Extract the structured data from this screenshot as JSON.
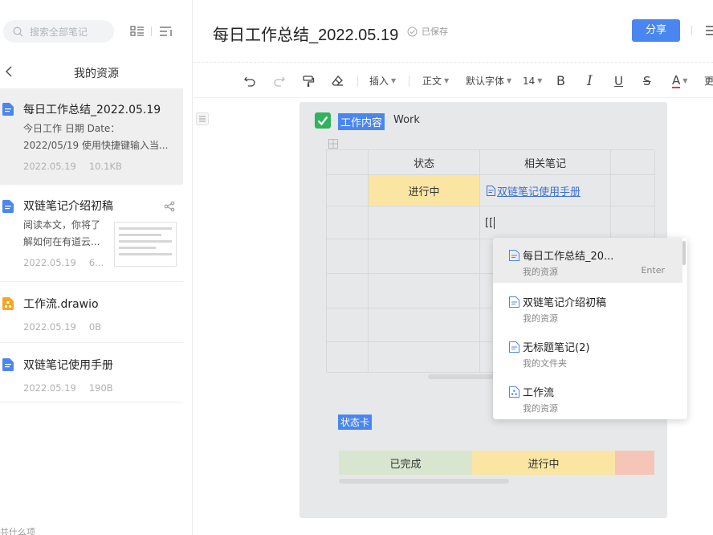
{
  "sidebar": {
    "search_placeholder": "搜索全部笔记",
    "folder_title": "我的资源",
    "files": [
      {
        "title": "每日工作总结_2022.05.19",
        "desc_line1": "今日工作 日期 Date：",
        "desc_line2": "2022/05/19 使用快捷键输入当...",
        "date": "2022.05.19",
        "size": "10.1KB"
      },
      {
        "title": "双链笔记介绍初稿",
        "desc_line1": "阅读本文，你将了",
        "desc_line2": "解如何在有道云...",
        "date": "2022.05.19",
        "size": "6..."
      },
      {
        "title": "工作流.drawio",
        "date": "2022.05.19",
        "size": "0B"
      },
      {
        "title": "双链笔记使用手册",
        "date": "2022.05.19",
        "size": "190B"
      }
    ],
    "footer": "共什么项"
  },
  "header": {
    "title": "每日工作总结_2022.05.19",
    "saved_status": "已保存",
    "share_label": "分享"
  },
  "toolbar": {
    "insert": "插入",
    "paragraph": "正文",
    "font": "默认字体",
    "size": "14",
    "bold": "B",
    "italic": "I",
    "underline": "U",
    "strike": "S",
    "color": "A",
    "more": "更"
  },
  "editor": {
    "heading_chip": "工作内容",
    "heading_text": "Work",
    "table": {
      "headers": [
        "状态",
        "相关笔记"
      ],
      "row1_status": "进行中",
      "row1_link": "双链笔记使用手册",
      "row2_typing": "[["
    },
    "status_chip": "状态卡",
    "status_bar": [
      "已完成",
      "进行中"
    ]
  },
  "link_popup": {
    "items": [
      {
        "title": "每日工作总结_20...",
        "location": "我的资源",
        "shortcut": "Enter"
      },
      {
        "title": "双链笔记介绍初稿",
        "location": "我的资源"
      },
      {
        "title": "无标题笔记(2)",
        "location": "我的文件夹"
      },
      {
        "title": "工作流",
        "location": "我的资源"
      }
    ]
  },
  "colors": {
    "accent": "#4a86f0",
    "status_yellow": "#fae6a2",
    "status_green": "#d9e6cf",
    "status_red": "#f5c5b8",
    "check_green": "#2fb35c"
  }
}
